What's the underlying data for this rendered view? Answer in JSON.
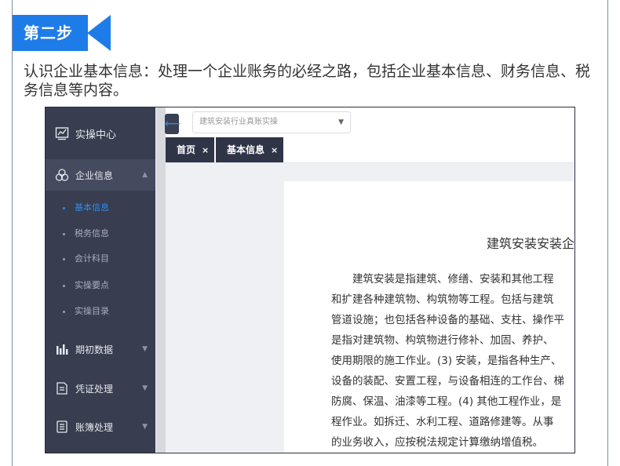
{
  "step_label": "第二步",
  "intro_text": "认识企业基本信息：处理一个企业账务的必经之路，包括企业基本信息、财务信息、税务信息等内容。",
  "sidebar": {
    "header": "实操中心",
    "menus": [
      {
        "label": "企业信息",
        "icon": "cluster-icon",
        "expanded": true,
        "children": [
          "基本信息",
          "税务信息",
          "会计科目",
          "实操要点",
          "实操目录"
        ]
      },
      {
        "label": "期初数据",
        "icon": "bar-chart-icon"
      },
      {
        "label": "凭证处理",
        "icon": "voucher-icon"
      },
      {
        "label": "账簿处理",
        "icon": "ledger-icon"
      }
    ]
  },
  "topbar": {
    "select_value": "建筑安装行业真账实操"
  },
  "tabs": [
    {
      "label": "首页",
      "close": "×"
    },
    {
      "label": "基本信息",
      "close": "×"
    }
  ],
  "document": {
    "title": "建筑安装安装企",
    "lines": [
      "　　建筑安装是指建筑、修缮、安装和其他工程",
      "和扩建各种建筑物、构筑物等工程。包括与建筑",
      "管道设施；也包括各种设备的基础、支柱、操作平",
      "是指对建筑物、构筑物进行修补、加固、养护、",
      "使用期限的施工作业。(3) 安装，是指各种生产、",
      "设备的装配、安置工程，与设备相连的工作台、梯",
      "防腐、保温、油漆等工程。(4) 其他工程作业，是",
      "程作业。如拆迁、水利工程、道路修建等。从事",
      "的业务收入，应按税法规定计算缴纳增值税。"
    ]
  },
  "colors": {
    "accent": "#1e7ce8",
    "sidebar": "#383d4f",
    "active_link": "#2d8cf0"
  }
}
